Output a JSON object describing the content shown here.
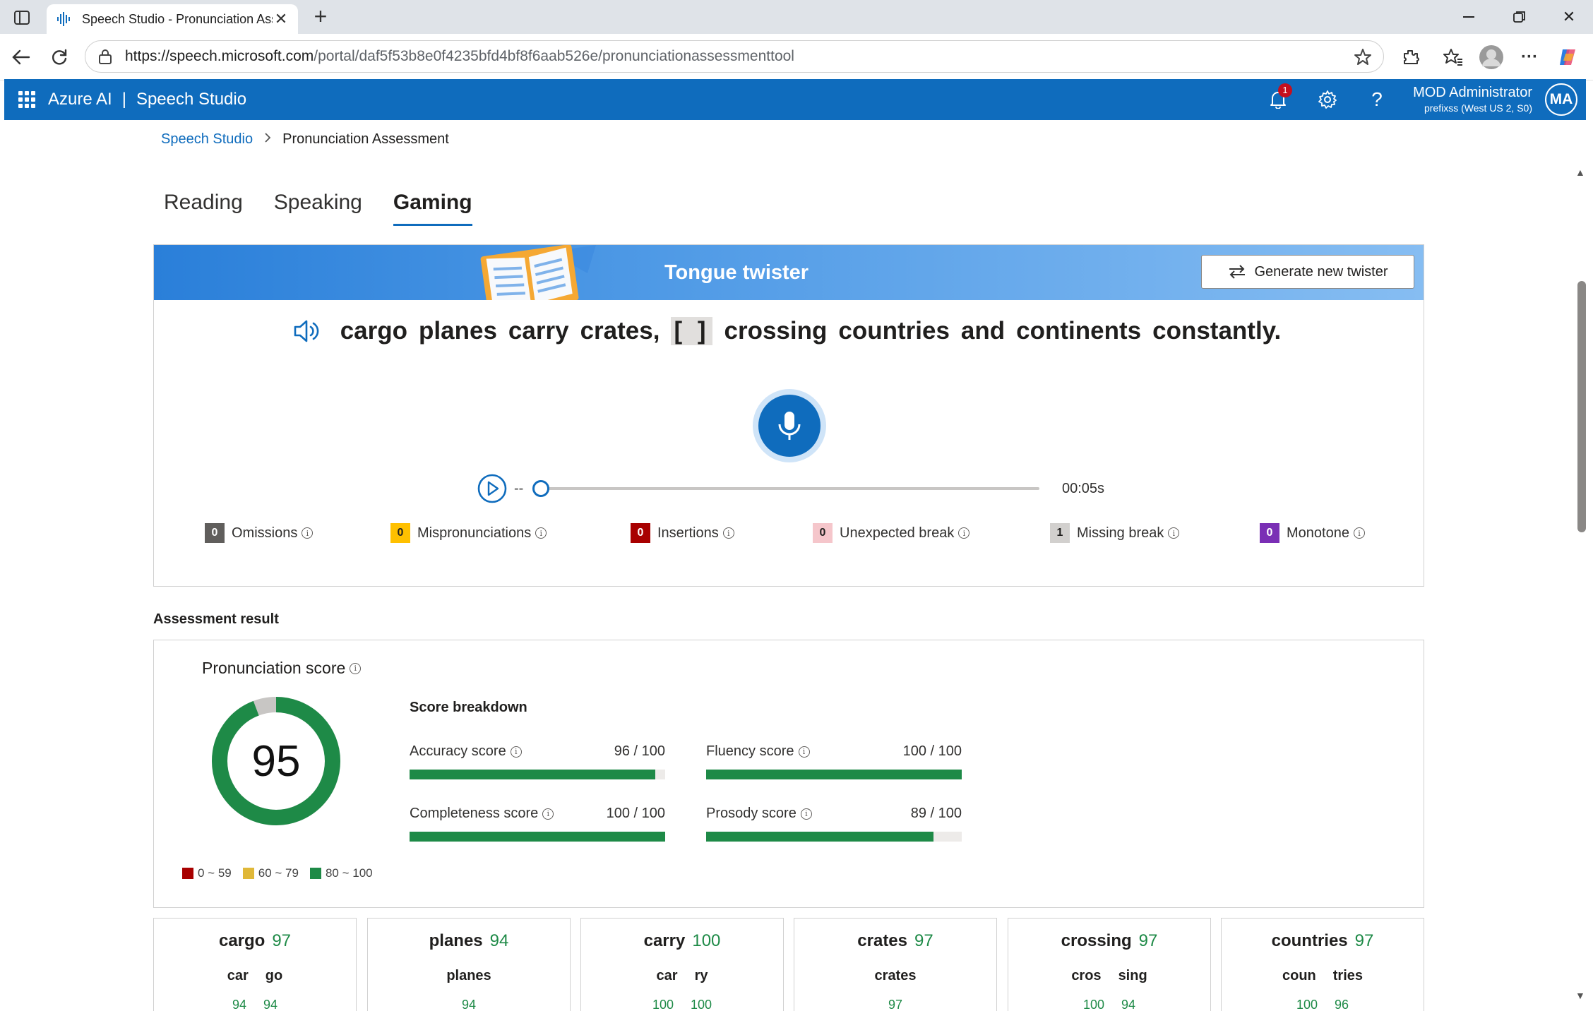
{
  "browser": {
    "tab_title": "Speech Studio - Pronunciation Assessment",
    "url_host": "https://speech.microsoft.com",
    "url_path": "/portal/daf5f53b8e0f4235bfd4bf8f6aab526e/pronunciationassessmenttool"
  },
  "header": {
    "brand": "Azure AI",
    "separator": "|",
    "product": "Speech Studio",
    "notification_count": "1",
    "user_name": "MOD Administrator",
    "user_sub": "prefixss (West US 2, S0)",
    "avatar_initials": "MA"
  },
  "breadcrumb": {
    "root": "Speech Studio",
    "current": "Pronunciation Assessment"
  },
  "tabs": [
    {
      "label": "Reading",
      "active": false
    },
    {
      "label": "Speaking",
      "active": false
    },
    {
      "label": "Gaming",
      "active": true
    }
  ],
  "twister": {
    "banner_title": "Tongue twister",
    "generate_label": "Generate new twister",
    "words": [
      "cargo",
      "planes",
      "carry",
      "crates,"
    ],
    "gap": "[ ]",
    "words_after": [
      "crossing",
      "countries",
      "and",
      "continents",
      "constantly."
    ]
  },
  "player": {
    "elapsed": "--",
    "duration": "00:05s",
    "progress": 0
  },
  "error_types": [
    {
      "count": "0",
      "label": "Omissions",
      "color": "#605e5c",
      "text_color": "#ffffff"
    },
    {
      "count": "0",
      "label": "Mispronunciations",
      "color": "#ffc000",
      "text_color": "#201f1e"
    },
    {
      "count": "0",
      "label": "Insertions",
      "color": "#a80000",
      "text_color": "#ffffff"
    },
    {
      "count": "0",
      "label": "Unexpected break",
      "color": "#f5c6cb",
      "text_color": "#201f1e"
    },
    {
      "count": "1",
      "label": "Missing break",
      "color": "#d2d0ce",
      "text_color": "#201f1e"
    },
    {
      "count": "0",
      "label": "Monotone",
      "color": "#7a2fb5",
      "text_color": "#ffffff"
    }
  ],
  "assessment": {
    "section_title": "Assessment result",
    "pron_title": "Pronunciation score",
    "pron_score": "95",
    "pron_value": 95,
    "breakdown_title": "Score breakdown",
    "scores": [
      {
        "label": "Accuracy score",
        "value_text": "96 / 100",
        "value": 96
      },
      {
        "label": "Fluency score",
        "value_text": "100 / 100",
        "value": 100
      },
      {
        "label": "Completeness score",
        "value_text": "100 / 100",
        "value": 100
      },
      {
        "label": "Prosody score",
        "value_text": "89 / 100",
        "value": 89
      }
    ],
    "legend": [
      {
        "label": "0 ~ 59",
        "color": "#a80000"
      },
      {
        "label": "60 ~ 79",
        "color": "#e0b838"
      },
      {
        "label": "80 ~ 100",
        "color": "#1e8a47"
      }
    ]
  },
  "word_results": [
    {
      "word": "cargo",
      "score": "97",
      "syllables": [
        "car",
        "go"
      ],
      "syllable_scores": [
        "94",
        "94"
      ]
    },
    {
      "word": "planes",
      "score": "94",
      "syllables": [
        "planes"
      ],
      "syllable_scores": [
        "94"
      ]
    },
    {
      "word": "carry",
      "score": "100",
      "syllables": [
        "car",
        "ry"
      ],
      "syllable_scores": [
        "100",
        "100"
      ]
    },
    {
      "word": "crates",
      "score": "97",
      "syllables": [
        "crates"
      ],
      "syllable_scores": [
        "97"
      ]
    },
    {
      "word": "crossing",
      "score": "97",
      "syllables": [
        "cros",
        "sing"
      ],
      "syllable_scores": [
        "100",
        "94"
      ]
    },
    {
      "word": "countries",
      "score": "97",
      "syllables": [
        "coun",
        "tries"
      ],
      "syllable_scores": [
        "100",
        "96"
      ]
    }
  ],
  "colors": {
    "accent": "#0f6cbd",
    "good": "#1e8a47",
    "donut_rest": "#c8c6c4"
  }
}
